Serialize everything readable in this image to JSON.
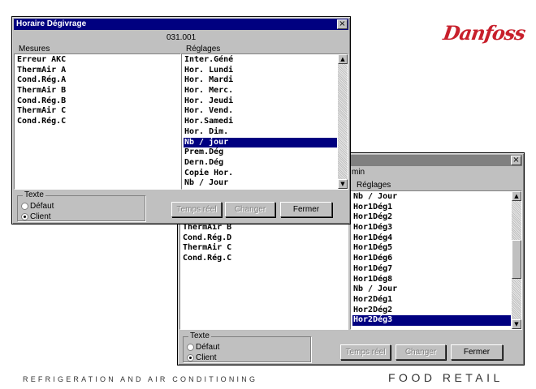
{
  "brand": {
    "logo_text": "Danfoss",
    "logo_color": "#c8202c"
  },
  "footer": {
    "left": "REFRIGERATION AND AIR CONDITIONING",
    "right": "FOOD RETAIL"
  },
  "window_front": {
    "title": "Horaire Dégivrage",
    "close_icon": "×",
    "code": "031.001",
    "mesures_label": "Mesures",
    "reglages_label": "Réglages",
    "mesures": [
      "Erreur AKC",
      "ThermAir A",
      "Cond.Rég.A",
      "ThermAir B",
      "Cond.Rég.B",
      "ThermAir C",
      "Cond.Rég.C"
    ],
    "reglages": [
      "Inter.Géné",
      "Hor. Lundi",
      "Hor. Mardi",
      "Hor. Merc.",
      "Hor. Jeudi",
      "Hor. Vend.",
      "Hor.Samedi",
      "Hor. Dim.",
      "Nb / jour",
      "Prem.Dég",
      "Dern.Dég",
      "Copie Hor.",
      "Nb / Jour"
    ],
    "texte": {
      "title": "Texte",
      "options": [
        "Défaut",
        "Client"
      ],
      "selected": "Client"
    },
    "buttons": {
      "temps_reel": "Temps réel",
      "changer": "Changer",
      "fermer": "Fermer"
    },
    "scroll": {
      "up_icon": "▲",
      "down_icon": "▼"
    }
  },
  "window_back": {
    "close_icon": "×",
    "code_fragment": "min",
    "reglages_label": "Réglages",
    "mesures": [
      "ThermAir B",
      "Cond.Rég.D",
      "ThermAir C",
      "Cond.Rég.C"
    ],
    "reglages": [
      "Nb / Jour",
      "Hor1Dég1",
      "Hor1Dég2",
      "Hor1Dég3",
      "Hor1Dég4",
      "Hor1Dég5",
      "Hor1Dég6",
      "Hor1Dég7",
      "Hor1Dég8",
      "Nb / Jour",
      "Hor2Dég1",
      "Hor2Dég2",
      "Hor2Dég3"
    ],
    "texte": {
      "title": "Texte",
      "options": [
        "Défaut",
        "Client"
      ],
      "selected": "Client"
    },
    "buttons": {
      "temps_reel": "Temps réel",
      "changer": "Changer",
      "fermer": "Fermer"
    },
    "scroll": {
      "up_icon": "▲",
      "down_icon": "▼"
    }
  }
}
